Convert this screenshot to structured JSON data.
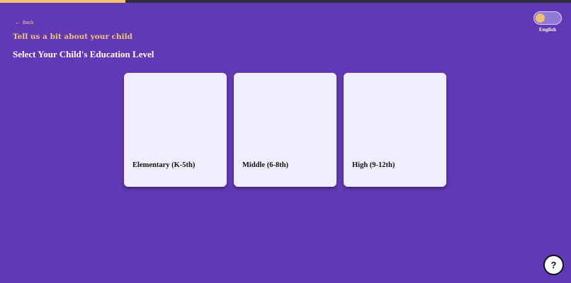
{
  "progress": {
    "fraction": 0.22
  },
  "colors": {
    "background": "#6139b6",
    "accent": "#f2c46d",
    "card": "#eeeefc",
    "progress_track": "#2c2c3a"
  },
  "nav": {
    "back_arrow_icon": "arrow-left-icon",
    "back_label": "Back"
  },
  "header": {
    "subtitle": "Tell us a bit about your child",
    "title": "Select Your Child's Education Level"
  },
  "language": {
    "label": "English"
  },
  "options": [
    {
      "label": "Elementary (K-5th)"
    },
    {
      "label": "Middle (6-8th)"
    },
    {
      "label": "High (9-12th)"
    }
  ],
  "help": {
    "label": "?"
  }
}
